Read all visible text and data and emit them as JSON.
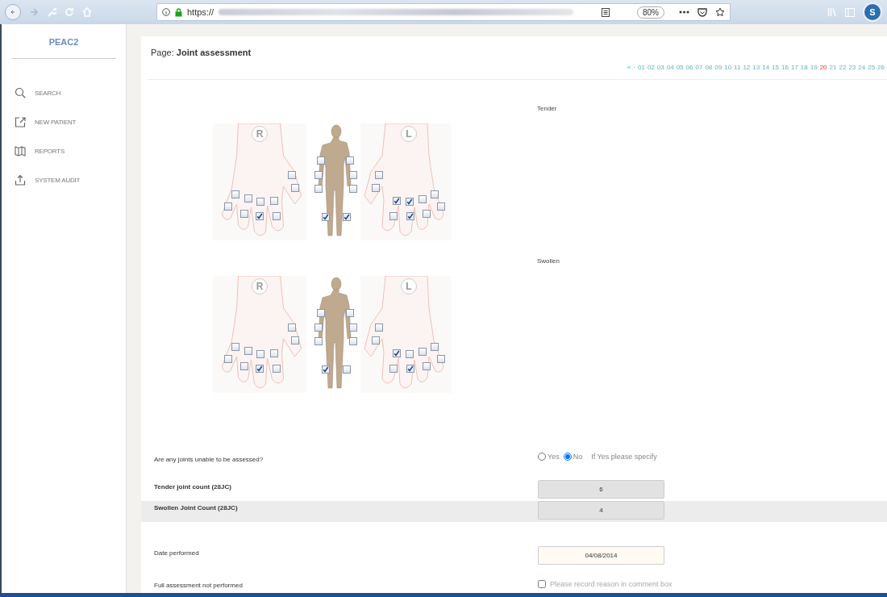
{
  "browser": {
    "url_scheme": "https://",
    "zoom": "80%",
    "profile_initial": "S",
    "forward_disabled": true
  },
  "sidebar": {
    "logo": "PEAC2",
    "items": [
      {
        "kind": "search",
        "label": "SEARCH"
      },
      {
        "kind": "new",
        "label": "NEW PATIENT"
      },
      {
        "kind": "reports",
        "label": "REPORTS"
      },
      {
        "kind": "audit",
        "label": "SYSTEM AUDIT"
      }
    ]
  },
  "page": {
    "prefix": "Page:",
    "title": "Joint assessment"
  },
  "pagination": {
    "first": "«",
    "separator": "·",
    "pages": [
      {
        "label": "01",
        "selected": false
      },
      {
        "label": "02",
        "selected": false
      },
      {
        "label": "03",
        "selected": false
      },
      {
        "label": "04",
        "selected": false
      },
      {
        "label": "05",
        "selected": false
      },
      {
        "label": "06",
        "selected": false
      },
      {
        "label": "07",
        "selected": false
      },
      {
        "label": "08",
        "selected": false
      },
      {
        "label": "09",
        "selected": false
      },
      {
        "label": "10",
        "selected": false
      },
      {
        "label": "11",
        "selected": false
      },
      {
        "label": "12",
        "selected": false
      },
      {
        "label": "13",
        "selected": false
      },
      {
        "label": "14",
        "selected": false
      },
      {
        "label": "15",
        "selected": false
      },
      {
        "label": "16",
        "selected": false
      },
      {
        "label": "17",
        "selected": false
      },
      {
        "label": "18",
        "selected": false
      },
      {
        "label": "19",
        "selected": false
      },
      {
        "label": "20",
        "selected": true
      },
      {
        "label": "21",
        "selected": false
      },
      {
        "label": "22",
        "selected": false
      },
      {
        "label": "23",
        "selected": false
      },
      {
        "label": "24",
        "selected": false
      },
      {
        "label": "25",
        "selected": false
      },
      {
        "label": "26",
        "selected": false
      }
    ]
  },
  "diagrams": [
    {
      "label": "Tender",
      "panels": [
        {
          "kind": "hand",
          "side_label": "R",
          "joints": [
            {
              "checked": false
            },
            {
              "checked": false
            },
            {
              "checked": false
            },
            {
              "checked": false
            },
            {
              "checked": false
            },
            {
              "checked": false
            },
            {
              "checked": false
            },
            {
              "checked": false
            },
            {
              "checked": true
            },
            {
              "checked": false
            }
          ]
        },
        {
          "kind": "body",
          "joints": [
            {
              "checked": false
            },
            {
              "checked": false
            },
            {
              "checked": false
            },
            {
              "checked": false
            },
            {
              "checked": false
            },
            {
              "checked": false
            },
            {
              "checked": true
            },
            {
              "checked": true
            }
          ]
        },
        {
          "kind": "hand",
          "side_label": "L",
          "joints": [
            {
              "checked": false
            },
            {
              "checked": false
            },
            {
              "checked": true
            },
            {
              "checked": true
            },
            {
              "checked": false
            },
            {
              "checked": false
            },
            {
              "checked": false
            },
            {
              "checked": false
            },
            {
              "checked": true
            },
            {
              "checked": false
            }
          ]
        }
      ]
    },
    {
      "label": "Swollen",
      "panels": [
        {
          "kind": "hand",
          "side_label": "R",
          "joints": [
            {
              "checked": false
            },
            {
              "checked": false
            },
            {
              "checked": false
            },
            {
              "checked": false
            },
            {
              "checked": false
            },
            {
              "checked": false
            },
            {
              "checked": false
            },
            {
              "checked": false
            },
            {
              "checked": true
            },
            {
              "checked": false
            }
          ]
        },
        {
          "kind": "body",
          "joints": [
            {
              "checked": false
            },
            {
              "checked": false
            },
            {
              "checked": false
            },
            {
              "checked": false
            },
            {
              "checked": false
            },
            {
              "checked": false
            },
            {
              "checked": true
            },
            {
              "checked": false
            }
          ]
        },
        {
          "kind": "hand",
          "side_label": "L",
          "joints": [
            {
              "checked": false
            },
            {
              "checked": false
            },
            {
              "checked": true
            },
            {
              "checked": false
            },
            {
              "checked": false
            },
            {
              "checked": false
            },
            {
              "checked": false
            },
            {
              "checked": false
            },
            {
              "checked": true
            },
            {
              "checked": false
            }
          ]
        }
      ]
    }
  ],
  "form": [
    {
      "kind": "radio",
      "label": "Are any joints unable to be assessed?",
      "options": [
        {
          "label": "Yes",
          "selected": false
        },
        {
          "label": "No",
          "selected": true
        }
      ],
      "hint": "If Yes please specify"
    },
    {
      "kind": "readonly",
      "label": "Tender joint count (28JC)",
      "value": "6",
      "striped": false
    },
    {
      "kind": "readonly",
      "label": "Swollen Joint Count (28JC)",
      "value": "4",
      "striped": true
    },
    {
      "kind": "date",
      "label": "Date performed",
      "value": "04/08/2014"
    },
    {
      "kind": "checkbox",
      "label": "Full assessment not performed",
      "checked": false,
      "text": "Please record reason in comment box"
    }
  ]
}
